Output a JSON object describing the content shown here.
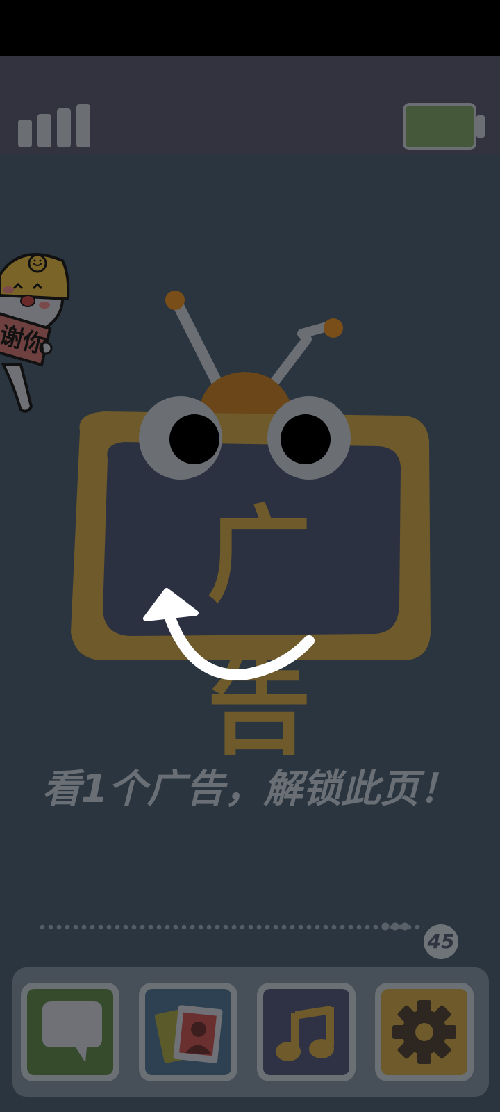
{
  "status": {
    "signal_icon": "signal-bars-icon",
    "battery_icon": "battery-icon"
  },
  "mascot": {
    "sign_text": "谢你"
  },
  "tv": {
    "screen_text": "广告"
  },
  "main": {
    "headline": "看1个广告，解锁此页！"
  },
  "progress": {
    "counter": "45",
    "fill": 0.96
  },
  "dock": {
    "apps": [
      {
        "icon": "chat-bubble-icon"
      },
      {
        "icon": "photos-icon"
      },
      {
        "icon": "music-note-icon"
      },
      {
        "icon": "gear-icon"
      }
    ]
  },
  "colors": {
    "background": "#2a3540",
    "tv_frame": "#6e5a2a",
    "tv_screen": "#2c3040",
    "accent_orange": "#7a5a2a"
  }
}
